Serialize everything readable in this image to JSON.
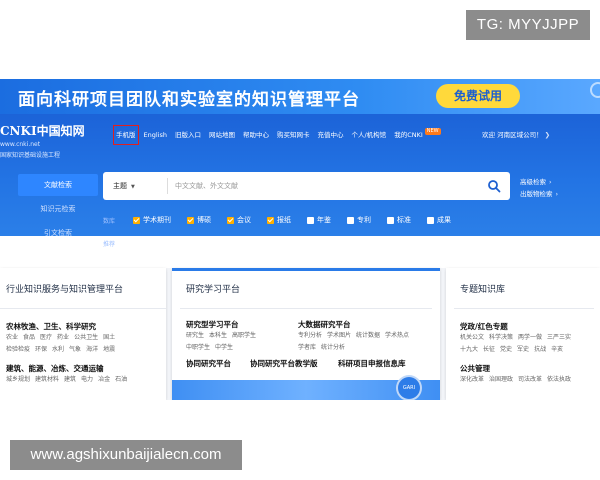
{
  "watermarks": {
    "top_right": "TG: MYYJJPP",
    "bottom_left": "www.agshixunbaijialecn.com"
  },
  "banner": {
    "title": "面向科研项目团队和实验室的知识管理平台",
    "cta": "免费试用"
  },
  "logo": {
    "brand": "CNKI中国知网",
    "url": "www.cnki.net",
    "subtitle": "国家知识基础设施工程"
  },
  "nav": {
    "items": [
      "手机版",
      "English",
      "旧版入口",
      "网站地图",
      "帮助中心",
      "购买知网卡",
      "充值中心",
      "个人/机构馆",
      "我的CNKI"
    ],
    "new_badge": "NEW",
    "welcome": "欢迎 河南区域公司！",
    "welcome_arrow": "❯"
  },
  "side_tabs": [
    "文献检索",
    "知识元检索",
    "引文检索"
  ],
  "search": {
    "category": "主题",
    "placeholder": "中文文献、外文文献",
    "advanced": "高级检索",
    "publication": "出版物检索",
    "arrow": "›"
  },
  "options": {
    "row1_label": "数库",
    "row1": [
      {
        "label": "学术期刊",
        "checked": true
      },
      {
        "label": "博硕",
        "checked": true
      },
      {
        "label": "会议",
        "checked": true
      },
      {
        "label": "报纸",
        "checked": true
      },
      {
        "label": "年鉴",
        "checked": false
      },
      {
        "label": "专利",
        "checked": false
      },
      {
        "label": "标准",
        "checked": false
      },
      {
        "label": "成果",
        "checked": false
      }
    ],
    "row2_label": "推荐",
    "row2": [
      {
        "label": "图书",
        "checked": false
      },
      {
        "label": "古籍",
        "checked": false
      },
      {
        "label": "法律法规",
        "checked": false
      }
    ],
    "row2_plain": [
      "政府文件",
      "企业标准",
      "科技报告",
      "政府采购"
    ]
  },
  "cards": {
    "industry": {
      "title": "行业知识服务与知识管理平台",
      "sections": [
        {
          "title": "农林牧渔、卫生、科学研究",
          "tags1": [
            "农业",
            "食品",
            "医疗",
            "药业",
            "公共卫生",
            "国土"
          ],
          "tags2": [
            "检验检疫",
            "环保",
            "水利",
            "气象",
            "海洋",
            "地震"
          ]
        },
        {
          "title": "建筑、能源、冶炼、交通运输",
          "tags1": [
            "城乡规划",
            "建筑材料",
            "建筑",
            "电力",
            "冶金",
            "石油"
          ]
        }
      ]
    },
    "research": {
      "title": "研究学习平台",
      "left": {
        "title": "研究型学习平台",
        "tags1": [
          "研究生",
          "本科生",
          "高职学生"
        ],
        "tags2": [
          "中职学生",
          "中学生"
        ]
      },
      "right": {
        "title": "大数据研究平台",
        "tags1": [
          "专利分析",
          "学术图片",
          "统计数据",
          "学术热点"
        ],
        "tags2": [
          "学者库",
          "统计分析"
        ]
      },
      "links": [
        "协同研究平台",
        "协同研究平台教学版",
        "科研项目申报信息库"
      ],
      "badge": "GARI"
    },
    "topics": {
      "title": "专题知识库",
      "sections": [
        {
          "title": "党政/红色专题",
          "tags1": [
            "机关公文",
            "科学决策",
            "两学一做",
            "三严三实"
          ],
          "tags2": [
            "十九大",
            "长征",
            "党史",
            "军史",
            "抗战",
            "辛亥"
          ]
        },
        {
          "title": "公共管理",
          "tags1": [
            "深化改革",
            "治国理政",
            "司法改革",
            "依法执政"
          ]
        }
      ]
    }
  }
}
